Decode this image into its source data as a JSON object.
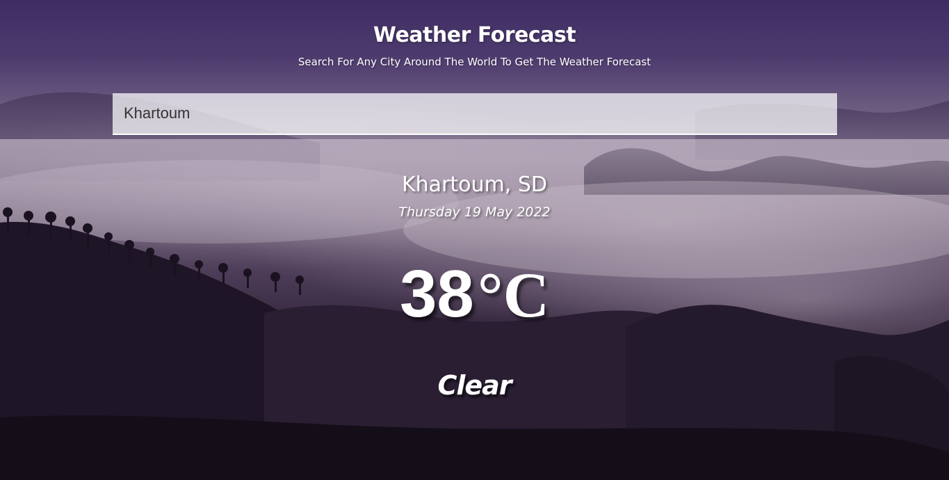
{
  "header": {
    "title": "Weather Forecast",
    "subtitle": "Search For Any City Around The World To Get The Weather Forecast"
  },
  "search": {
    "value": "Khartoum",
    "placeholder": ""
  },
  "weather": {
    "location": "Khartoum, SD",
    "date": "Thursday 19 May 2022",
    "temperature": "38",
    "unit": "°C",
    "condition": "Clear"
  },
  "colors": {
    "sky_top": "#3f2c63",
    "haze": "#7e6f88",
    "ground": "#1a1320",
    "text": "#ffffff",
    "input_bg": "rgba(255,255,255,0.72)"
  }
}
